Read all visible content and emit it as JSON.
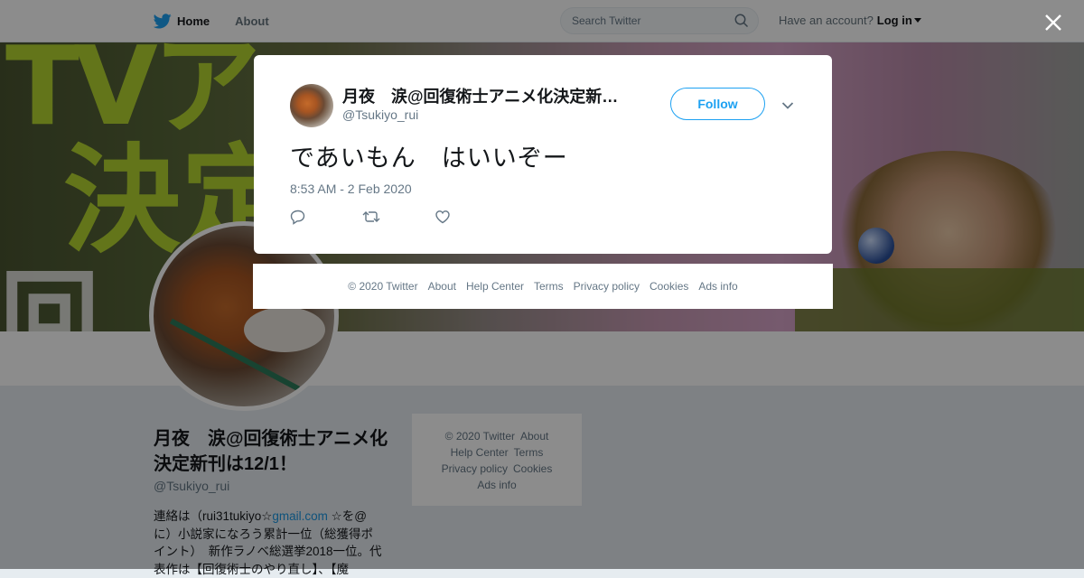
{
  "nav": {
    "home_label": "Home",
    "about_label": "About",
    "search_placeholder": "Search Twitter",
    "account_prompt": "Have an account?",
    "login_label": "Log in"
  },
  "profile": {
    "name": "月夜　涙@回復術士アニメ化決定新刊は12/1！",
    "handle": "@Tsukiyo_rui",
    "bio_part1": "連絡は（rui31tukiyo☆",
    "bio_link": "gmail.com",
    "bio_part2": " ☆を@に）小説家になろう累計一位（総獲得ポイント）　新作ラノベ総選挙2018一位。代表作は【回復術士のやり直し】、【魔"
  },
  "side_footer": {
    "copyright": "© 2020 Twitter",
    "about": "About",
    "help": "Help Center",
    "terms": "Terms",
    "privacy": "Privacy policy",
    "cookies": "Cookies",
    "ads": "Ads info"
  },
  "tweet": {
    "name": "月夜　涙@回復術士アニメ化決定新刊は12/1！",
    "handle": "@Tsukiyo_rui",
    "follow_label": "Follow",
    "text": "であいもん　はいいぞー",
    "timestamp": "8:53 AM - 2 Feb 2020"
  },
  "modal_footer": {
    "copyright": "© 2020 Twitter",
    "about": "About",
    "help": "Help Center",
    "terms": "Terms",
    "privacy": "Privacy policy",
    "cookies": "Cookies",
    "ads": "Ads info"
  },
  "icons": {
    "logo": "twitter-bird-icon",
    "search": "search-icon",
    "close": "close-icon",
    "menu": "chevron-down-icon",
    "reply": "reply-icon",
    "retweet": "retweet-icon",
    "like": "heart-icon"
  },
  "colors": {
    "accent": "#1da1f2",
    "link": "#1b95e0",
    "secondary_text": "#657786"
  }
}
